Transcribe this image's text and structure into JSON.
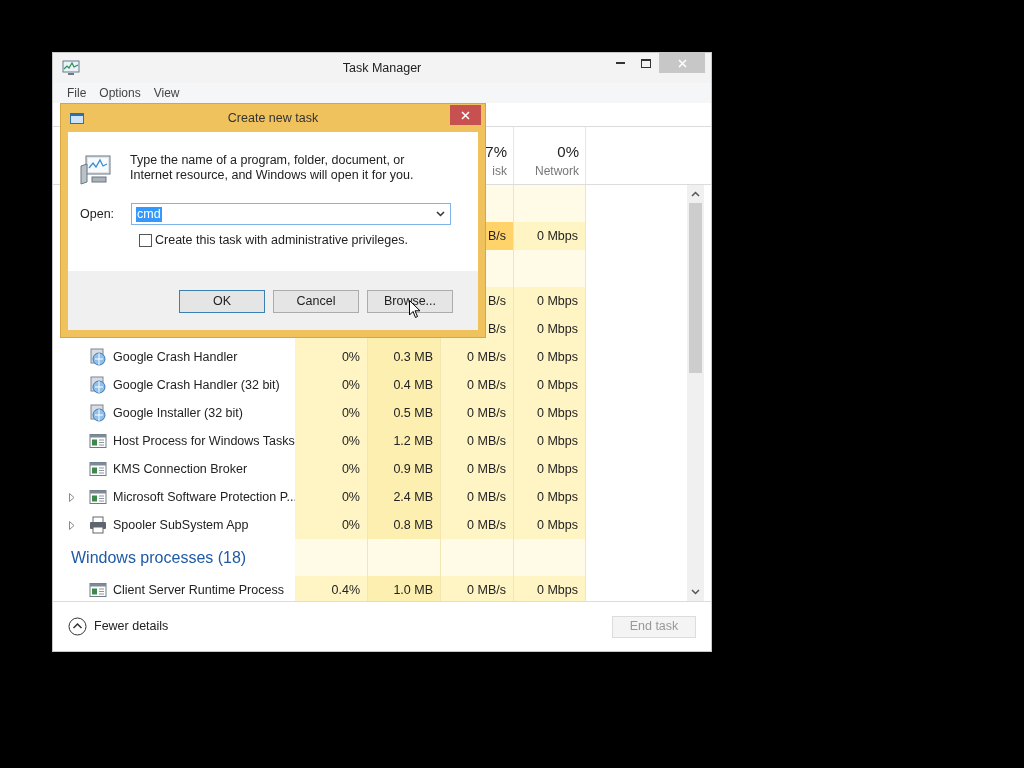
{
  "window": {
    "title": "Task Manager"
  },
  "menu": [
    "File",
    "Options",
    "View"
  ],
  "headers": {
    "disk": {
      "percent": "7%",
      "label": "isk"
    },
    "network": {
      "percent": "0%",
      "label": "Network"
    }
  },
  "rows": [
    {
      "kind": "group"
    },
    {
      "kind": "partial",
      "disk": "B/s",
      "network": "0 Mbps",
      "disk_hot": true
    },
    {
      "kind": "group"
    },
    {
      "kind": "partial",
      "disk": "B/s",
      "network": "0 Mbps",
      "disk_hot": false
    },
    {
      "kind": "partial",
      "disk": "B/s",
      "network": "0 Mbps",
      "disk_hot": false
    },
    {
      "kind": "installer",
      "name": "Google Crash Handler",
      "cpu": "0%",
      "memory": "0.3 MB",
      "disk": "0 MB/s",
      "network": "0 Mbps",
      "expandable": false,
      "disk_hot": false
    },
    {
      "kind": "installer",
      "name": "Google Crash Handler (32 bit)",
      "cpu": "0%",
      "memory": "0.4 MB",
      "disk": "0 MB/s",
      "network": "0 Mbps",
      "expandable": false,
      "disk_hot": false
    },
    {
      "kind": "installer",
      "name": "Google Installer (32 bit)",
      "cpu": "0%",
      "memory": "0.5 MB",
      "disk": "0 MB/s",
      "network": "0 Mbps",
      "expandable": false,
      "disk_hot": false
    },
    {
      "kind": "window",
      "name": "Host Process for Windows Tasks",
      "cpu": "0%",
      "memory": "1.2 MB",
      "disk": "0 MB/s",
      "network": "0 Mbps",
      "expandable": false,
      "disk_hot": false
    },
    {
      "kind": "window",
      "name": "KMS Connection Broker",
      "cpu": "0%",
      "memory": "0.9 MB",
      "disk": "0 MB/s",
      "network": "0 Mbps",
      "expandable": false,
      "disk_hot": false
    },
    {
      "kind": "window",
      "name": "Microsoft Software Protection P...",
      "cpu": "0%",
      "memory": "2.4 MB",
      "disk": "0 MB/s",
      "network": "0 Mbps",
      "expandable": true,
      "disk_hot": false
    },
    {
      "kind": "printer",
      "name": "Spooler SubSystem App",
      "cpu": "0%",
      "memory": "0.8 MB",
      "disk": "0 MB/s",
      "network": "0 Mbps",
      "expandable": true,
      "disk_hot": false
    },
    {
      "kind": "group",
      "title": "Windows processes (18)"
    },
    {
      "kind": "window",
      "name": "Client Server Runtime Process",
      "cpu": "0.4%",
      "memory": "1.0 MB",
      "disk": "0 MB/s",
      "network": "0 Mbps",
      "expandable": false,
      "disk_hot": false
    }
  ],
  "footer": {
    "toggle": "Fewer details",
    "end_task": {
      "label": "End task",
      "disabled": true
    }
  },
  "dialog": {
    "title": "Create new task",
    "message": "Type the name of a program, folder, document, or Internet resource, and Windows will open it for you.",
    "open_label": "Open:",
    "open_value": "cmd",
    "admin": {
      "label": "Create this task with administrative privileges.",
      "checked": false
    },
    "buttons": [
      "OK",
      "Cancel",
      "Browse..."
    ]
  }
}
